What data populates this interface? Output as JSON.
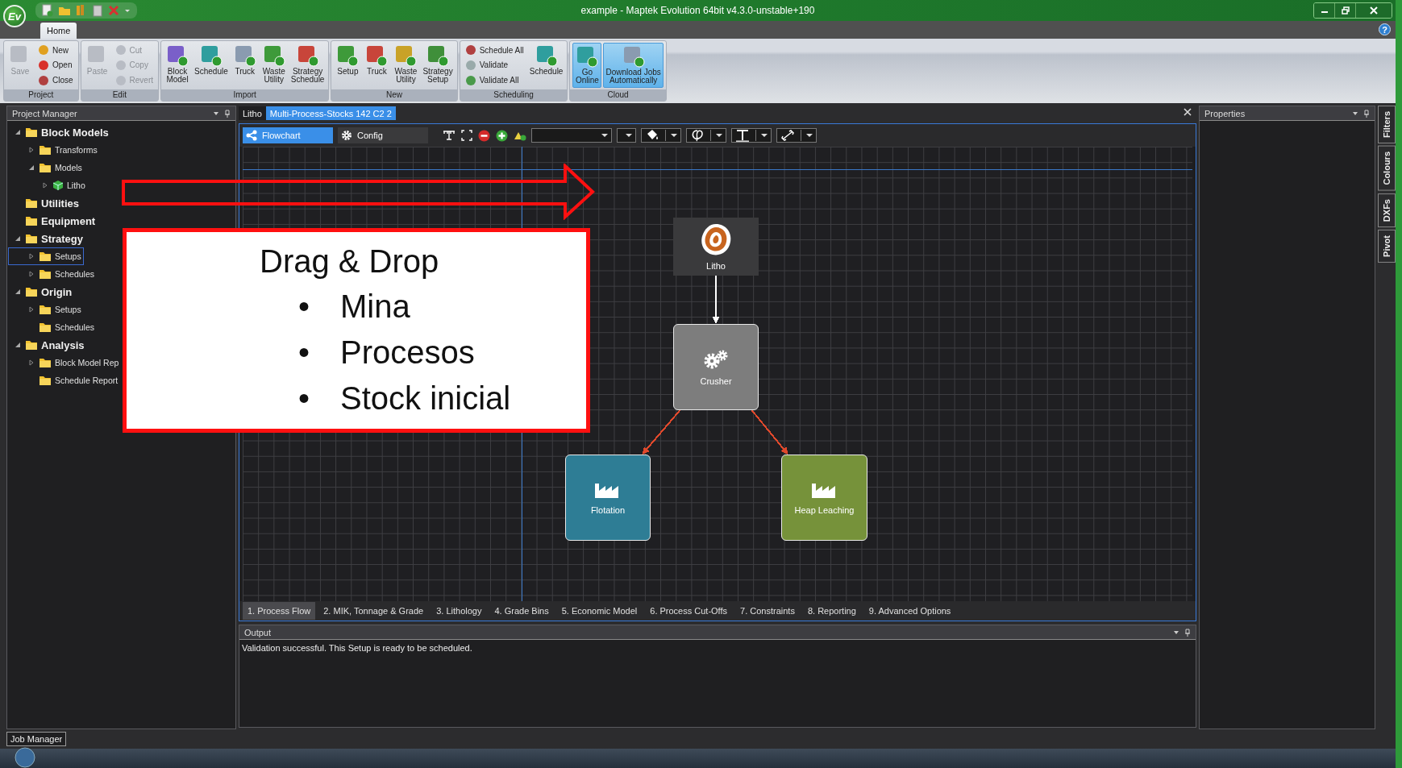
{
  "window": {
    "logo_text": "Ev",
    "title": "example - Maptek Evolution 64bit v4.3.0-unstable+190",
    "help_label": "?"
  },
  "ribbon_tabs": [
    {
      "label": "Home",
      "selected": true
    }
  ],
  "ribbon_groups": [
    {
      "label": "Project",
      "items": [
        {
          "label": "Save",
          "kind": "large",
          "disabled": true
        },
        {
          "label": "New",
          "kind": "small",
          "disabled": false
        },
        {
          "label": "Open",
          "kind": "small",
          "disabled": false
        },
        {
          "label": "Close",
          "kind": "small",
          "disabled": false
        }
      ]
    },
    {
      "label": "Edit",
      "items": [
        {
          "label": "Paste",
          "kind": "large",
          "disabled": true
        },
        {
          "label": "Cut",
          "kind": "small",
          "disabled": true
        },
        {
          "label": "Copy",
          "kind": "small",
          "disabled": true
        },
        {
          "label": "Revert",
          "kind": "small",
          "disabled": true
        }
      ]
    },
    {
      "label": "Import",
      "items": [
        {
          "label": "Block\nModel",
          "kind": "large",
          "disabled": false
        },
        {
          "label": "Schedule",
          "kind": "large",
          "disabled": false
        },
        {
          "label": "Truck",
          "kind": "large",
          "disabled": false
        },
        {
          "label": "Waste\nUtility",
          "kind": "large",
          "disabled": false
        },
        {
          "label": "Strategy\nSchedule",
          "kind": "large",
          "disabled": false
        }
      ]
    },
    {
      "label": "New",
      "items": [
        {
          "label": "Setup",
          "kind": "large",
          "disabled": false
        },
        {
          "label": "Truck",
          "kind": "large",
          "disabled": false
        },
        {
          "label": "Waste\nUtility",
          "kind": "large",
          "disabled": false
        },
        {
          "label": "Strategy\nSetup",
          "kind": "large",
          "disabled": false
        }
      ]
    },
    {
      "label": "Scheduling",
      "items": [
        {
          "label": "Schedule All",
          "kind": "small",
          "disabled": false
        },
        {
          "label": "Validate",
          "kind": "small",
          "disabled": false
        },
        {
          "label": "Validate All",
          "kind": "small",
          "disabled": false
        },
        {
          "label": "Schedule",
          "kind": "large",
          "disabled": false
        }
      ]
    },
    {
      "label": "Cloud",
      "items": [
        {
          "label": "Go\nOnline",
          "kind": "large",
          "disabled": false,
          "selected": true
        },
        {
          "label": "Download Jobs\nAutomatically",
          "kind": "large",
          "disabled": false,
          "selected": true
        }
      ]
    }
  ],
  "project_manager": {
    "title": "Project Manager",
    "tree": [
      {
        "label": "Block Models",
        "kind": "folder",
        "selected": false,
        "expanded": true,
        "children": [
          {
            "label": "Transforms",
            "kind": "folder",
            "selected": false,
            "expanded": false
          },
          {
            "label": "Models",
            "kind": "folder",
            "selected": false,
            "expanded": true,
            "children": [
              {
                "label": "Litho",
                "kind": "model",
                "selected": false,
                "expanded": false
              }
            ]
          }
        ]
      },
      {
        "label": "Utilities",
        "kind": "folder",
        "selected": false
      },
      {
        "label": "Equipment",
        "kind": "folder",
        "selected": false
      },
      {
        "label": "Strategy",
        "kind": "folder",
        "selected": false,
        "expanded": true,
        "children": [
          {
            "label": "Setups",
            "kind": "folder",
            "selected": true,
            "expanded": false
          },
          {
            "label": "Schedules",
            "kind": "folder",
            "selected": false,
            "expanded": false
          }
        ]
      },
      {
        "label": "Origin",
        "kind": "folder",
        "selected": false,
        "expanded": true,
        "children": [
          {
            "label": "Setups",
            "kind": "folder",
            "selected": false,
            "expanded": false
          },
          {
            "label": "Schedules",
            "kind": "folder",
            "selected": false
          }
        ]
      },
      {
        "label": "Analysis",
        "kind": "folder",
        "selected": false,
        "expanded": true,
        "children": [
          {
            "label": "Block Model Rep",
            "kind": "folder",
            "selected": false,
            "expanded": false
          },
          {
            "label": "Schedule Report",
            "kind": "folder",
            "selected": false
          }
        ]
      }
    ]
  },
  "document_tabs": [
    {
      "label": "Litho",
      "selected": false
    },
    {
      "label": "Multi-Process-Stocks 142 C2 2",
      "selected": true
    }
  ],
  "view_tabs": [
    {
      "label": "Flowchart",
      "selected": true
    },
    {
      "label": "Config",
      "selected": false
    }
  ],
  "flowchart": {
    "nodes": [
      {
        "label": "Litho",
        "kind": "source",
        "color": "#3a3a3c"
      },
      {
        "label": "Crusher",
        "kind": "crusher",
        "color": "#7d7d7d"
      },
      {
        "label": "Flotation",
        "kind": "plant",
        "color": "#2e7d95"
      },
      {
        "label": "Heap Leaching",
        "kind": "plant",
        "color": "#76923a"
      }
    ],
    "edges": [
      {
        "color": "#ffffff"
      },
      {
        "color": "#e0492c"
      },
      {
        "color": "#e0492c"
      }
    ]
  },
  "step_tabs": [
    {
      "label": "1. Process Flow",
      "selected": true
    },
    {
      "label": "2. MIK, Tonnage & Grade",
      "selected": false
    },
    {
      "label": "3. Lithology",
      "selected": false
    },
    {
      "label": "4. Grade Bins",
      "selected": false
    },
    {
      "label": "5. Economic Model",
      "selected": false
    },
    {
      "label": "6. Process Cut-Offs",
      "selected": false
    },
    {
      "label": "7. Constraints",
      "selected": false
    },
    {
      "label": "8. Reporting",
      "selected": false
    },
    {
      "label": "9. Advanced Options",
      "selected": false
    }
  ],
  "output": {
    "title": "Output",
    "message": "Validation successful. This Setup is ready to be scheduled."
  },
  "properties": {
    "title": "Properties"
  },
  "side_tabs": [
    {
      "label": "Filters"
    },
    {
      "label": "Colours"
    },
    {
      "label": "DXFs"
    },
    {
      "label": "Pivot"
    }
  ],
  "job_manager": {
    "label": "Job Manager"
  },
  "callout": {
    "heading": "Drag & Drop",
    "bullets": [
      {
        "marker": "•",
        "text": "Mina"
      },
      {
        "marker": "•",
        "text": "Procesos"
      },
      {
        "marker": "•",
        "text": "Stock inicial"
      }
    ]
  }
}
